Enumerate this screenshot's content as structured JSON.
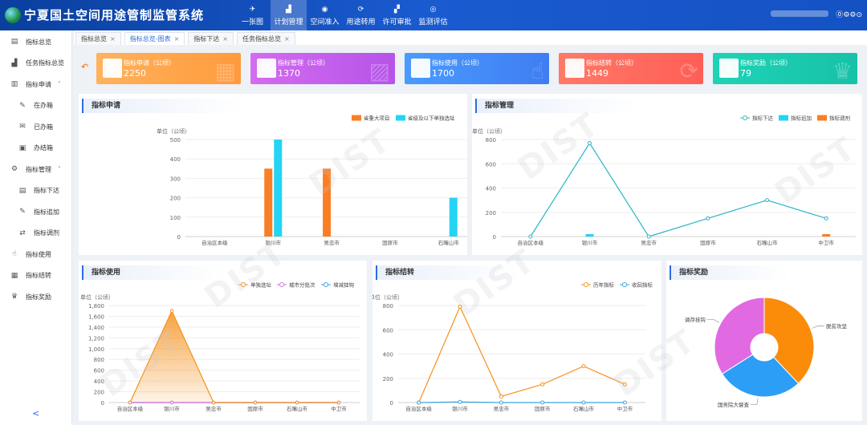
{
  "header": {
    "title": "宁夏国土空间用途管制监管系统",
    "nav": [
      {
        "label": "一张图",
        "icon": "✈"
      },
      {
        "label": "计划管理",
        "icon": "▟"
      },
      {
        "label": "空间准入",
        "icon": "◉"
      },
      {
        "label": "用途转用",
        "icon": "⟳"
      },
      {
        "label": "许可审批",
        "icon": "▞"
      },
      {
        "label": "监测评估",
        "icon": "◎"
      }
    ],
    "icons": "⓪⚙⚙⊙"
  },
  "sidebar": {
    "items": [
      {
        "label": "指标总览",
        "icon": "▤"
      },
      {
        "label": "任务指标总览",
        "icon": "▟"
      },
      {
        "label": "指标申请",
        "icon": "▥",
        "caret": "˄"
      },
      {
        "label": "在办箱",
        "icon": "✎"
      },
      {
        "label": "已办箱",
        "icon": "✉"
      },
      {
        "label": "办结箱",
        "icon": "▣"
      },
      {
        "label": "指标管理",
        "icon": "⚙",
        "caret": "˄"
      },
      {
        "label": "指标下达",
        "icon": "▤"
      },
      {
        "label": "指标追加",
        "icon": "✎"
      },
      {
        "label": "指标调剂",
        "icon": "⇄"
      },
      {
        "label": "指标使用",
        "icon": "☝"
      },
      {
        "label": "指标结转",
        "icon": "▦"
      },
      {
        "label": "指标奖励",
        "icon": "♛"
      }
    ],
    "collapse": "<"
  },
  "tabs": [
    {
      "label": "指标总览",
      "close": "×"
    },
    {
      "label": "指标总览-图表",
      "close": "×"
    },
    {
      "label": "指标下达",
      "close": "×"
    },
    {
      "label": "任务指标总览",
      "close": "×"
    }
  ],
  "back": "↶",
  "cards": [
    {
      "label": "指标申请（公顷）",
      "value": "2250",
      "color1": "#ffb25c",
      "color2": "#ff9a3d",
      "icon": "▦"
    },
    {
      "label": "指标管理（公顷）",
      "value": "1370",
      "color1": "#d46cf0",
      "color2": "#b554e8",
      "icon": "▨"
    },
    {
      "label": "指标使用（公顷）",
      "value": "1700",
      "color1": "#4a9bff",
      "color2": "#3f7df2",
      "icon": "☝"
    },
    {
      "label": "指标结转（公顷）",
      "value": "1449",
      "color1": "#ff7a66",
      "color2": "#ff5e57",
      "icon": "⟳"
    },
    {
      "label": "指标奖励（公顷）",
      "value": "79",
      "color1": "#1ed3b6",
      "color2": "#17c2a8",
      "icon": "♛"
    }
  ],
  "watermark": "DIST",
  "charts": {
    "apply": {
      "title": "指标申请",
      "unit": "单位（公顷）",
      "yTicks": [
        "0",
        "100",
        "200",
        "300",
        "400",
        "500"
      ]
    },
    "manage": {
      "title": "指标管理",
      "unit": "单位（公顷）",
      "yTicks": [
        "0",
        "200",
        "400",
        "600",
        "800"
      ]
    },
    "use": {
      "title": "指标使用",
      "unit": "单位（公顷）",
      "yTicks": [
        "0",
        "200",
        "400",
        "600",
        "800",
        "1,000",
        "1,200",
        "1,400",
        "1,600",
        "1,800"
      ]
    },
    "carry": {
      "title": "指标结转",
      "unit": "单位（公顷）",
      "yTicks": [
        "0",
        "200",
        "400",
        "600",
        "800"
      ]
    },
    "reward": {
      "title": "指标奖励"
    }
  },
  "chart_data": [
    {
      "type": "bar",
      "title": "指标申请",
      "ylabel": "单位（公顷）",
      "ylim": [
        0,
        500
      ],
      "categories": [
        "自治区本级",
        "银川市",
        "吴忠市",
        "固原市",
        "石嘴山市",
        "中卫市"
      ],
      "series": [
        {
          "name": "省重大项目",
          "color": "#fa7e23",
          "values": [
            0,
            350,
            350,
            0,
            0,
            0
          ]
        },
        {
          "name": "省级及以下单独选址",
          "color": "#25d4f3",
          "values": [
            0,
            500,
            0,
            0,
            200,
            0
          ]
        }
      ]
    },
    {
      "type": "line",
      "title": "指标管理",
      "ylabel": "单位（公顷）",
      "ylim": [
        0,
        800
      ],
      "categories": [
        "自治区本级",
        "银川市",
        "吴忠市",
        "固原市",
        "石嘴山市",
        "中卫市"
      ],
      "series": [
        {
          "name": "指标下达",
          "kind": "line",
          "color": "#2bb6c6",
          "values": [
            0,
            770,
            0,
            150,
            300,
            150
          ]
        },
        {
          "name": "指标追加",
          "kind": "bar",
          "color": "#25d4f3",
          "values": [
            0,
            20,
            0,
            0,
            0,
            0
          ]
        },
        {
          "name": "指标调剂",
          "kind": "bar",
          "color": "#fa7e23",
          "values": [
            0,
            0,
            0,
            0,
            0,
            20
          ]
        }
      ]
    },
    {
      "type": "area",
      "title": "指标使用",
      "ylabel": "单位（公顷）",
      "ylim": [
        0,
        1800
      ],
      "categories": [
        "自治区本级",
        "银川市",
        "吴忠市",
        "固原市",
        "石嘴山市",
        "中卫市"
      ],
      "series": [
        {
          "name": "单独选址",
          "color": "#f5921e",
          "values": [
            0,
            1700,
            0,
            0,
            0,
            0
          ]
        },
        {
          "name": "城市分批次",
          "color": "#d96ee6",
          "values": [
            0,
            0,
            0,
            0,
            0,
            0
          ]
        },
        {
          "name": "增减挂钩",
          "color": "#3ba5e0",
          "values": [
            0,
            0,
            0,
            0,
            0,
            0
          ]
        }
      ]
    },
    {
      "type": "line",
      "title": "指标结转",
      "ylabel": "单位（公顷）",
      "ylim": [
        0,
        800
      ],
      "categories": [
        "自治区本级",
        "银川市",
        "吴忠市",
        "固原市",
        "石嘴山市",
        "中卫市"
      ],
      "series": [
        {
          "name": "历年指标",
          "color": "#f5921e",
          "values": [
            0,
            790,
            50,
            150,
            300,
            150
          ]
        },
        {
          "name": "收回指标",
          "color": "#3ba5e0",
          "values": [
            0,
            5,
            0,
            0,
            0,
            0
          ]
        }
      ]
    },
    {
      "type": "pie",
      "title": "指标奖励",
      "donut": true,
      "slices": [
        {
          "name": "脱贫攻坚",
          "value": 38,
          "color": "#fb8c0a"
        },
        {
          "name": "国务院大督查",
          "value": 28,
          "color": "#2c9ef5"
        },
        {
          "name": "调存挂钩",
          "value": 34,
          "color": "#e16ae3"
        }
      ]
    }
  ]
}
